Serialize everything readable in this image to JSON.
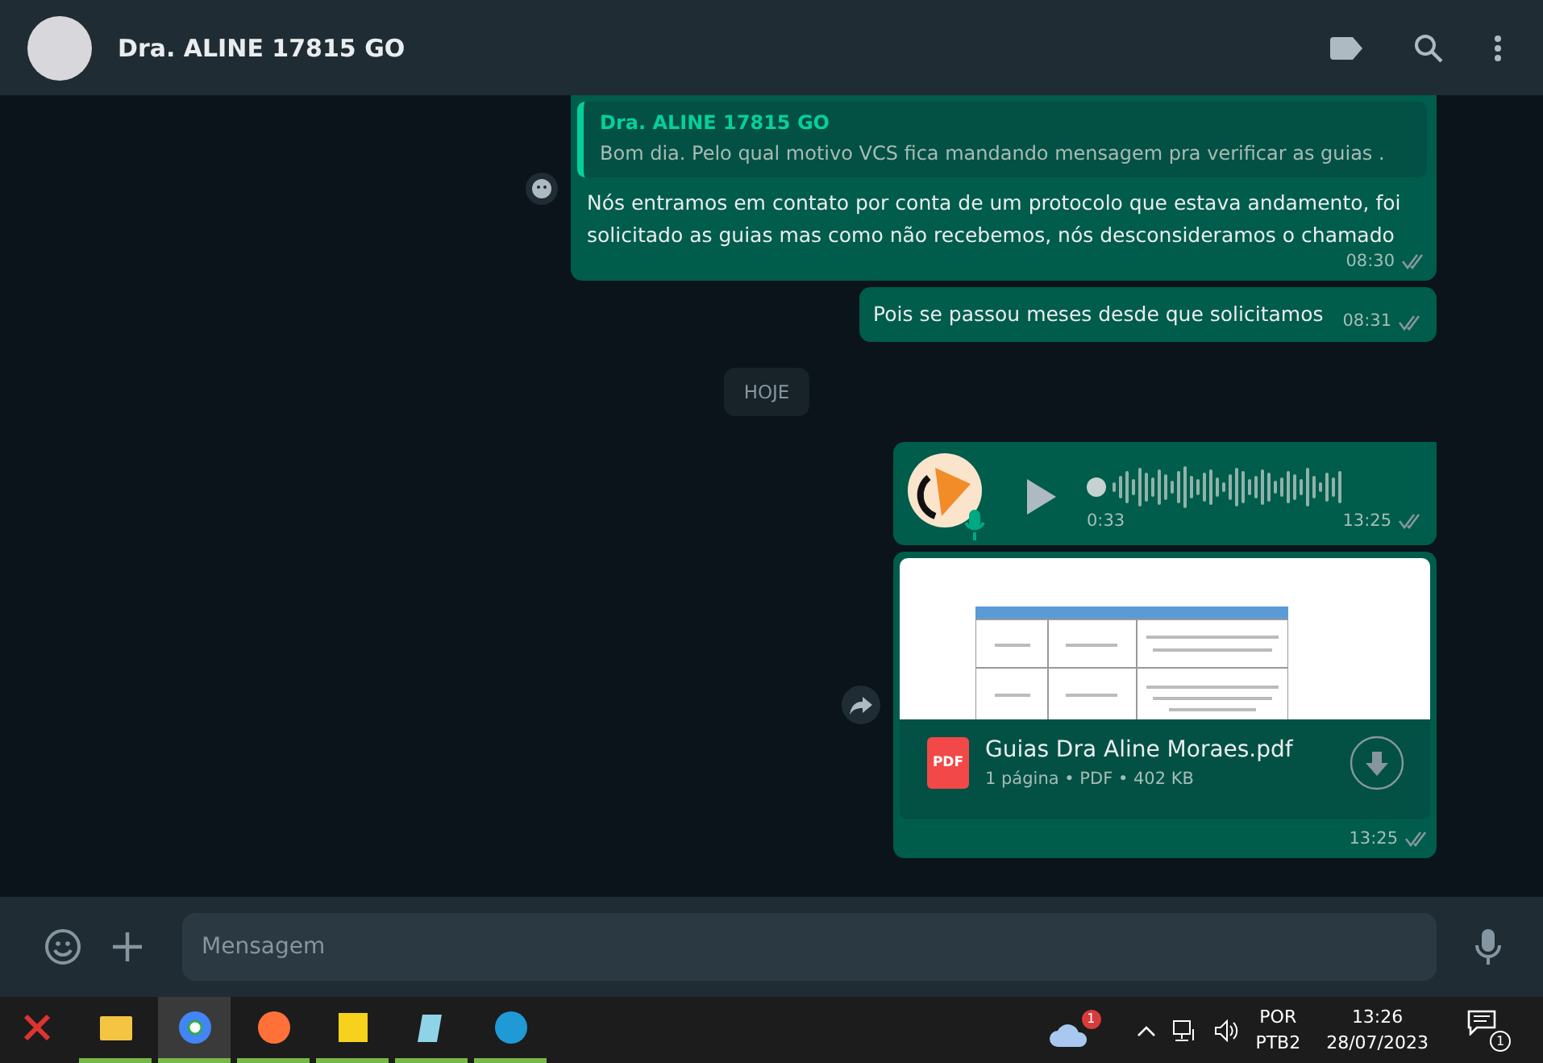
{
  "header": {
    "contact_name": "Dra. ALINE 17815 GO"
  },
  "messages": [
    {
      "kind": "quoted",
      "quote_author": "Dra. ALINE 17815 GO",
      "quote_text": "Bom dia. Pelo qual motivo VCS fica mandando mensagem pra verificar as guias .",
      "text": "Nós entramos em contato por conta de um protocolo que estava andamento, foi solicitado as guias mas como não recebemos, nós desconsideramos o chamado",
      "time": "08:30"
    },
    {
      "kind": "text",
      "text": "Pois se passou meses desde que solicitamos",
      "time": "08:31"
    },
    {
      "kind": "date",
      "text": "HOJE"
    },
    {
      "kind": "audio",
      "duration": "0:33",
      "level": 0,
      "time": "13:25"
    },
    {
      "kind": "document",
      "file_name": "Guias Dra Aline Moraes.pdf",
      "file_type": "PDF",
      "file_meta": "1 página • PDF • 402 KB",
      "time": "13:25"
    }
  ],
  "composer": {
    "placeholder": "Mensagem"
  },
  "taskbar": {
    "apps": [
      {
        "kind": "snip",
        "running": false,
        "selected": false
      },
      {
        "kind": "folder",
        "running": true,
        "selected": false
      },
      {
        "kind": "chrome",
        "running": true,
        "selected": true
      },
      {
        "kind": "firefox",
        "running": true,
        "selected": false
      },
      {
        "kind": "notes",
        "running": true,
        "selected": false
      },
      {
        "kind": "notepad",
        "running": true,
        "selected": false
      },
      {
        "kind": "edge",
        "running": true,
        "selected": false
      }
    ],
    "cloud_badge": "1",
    "language": "POR",
    "layout": "PTB2",
    "time": "13:26",
    "date": "28/07/2023",
    "notification_count": "1"
  }
}
